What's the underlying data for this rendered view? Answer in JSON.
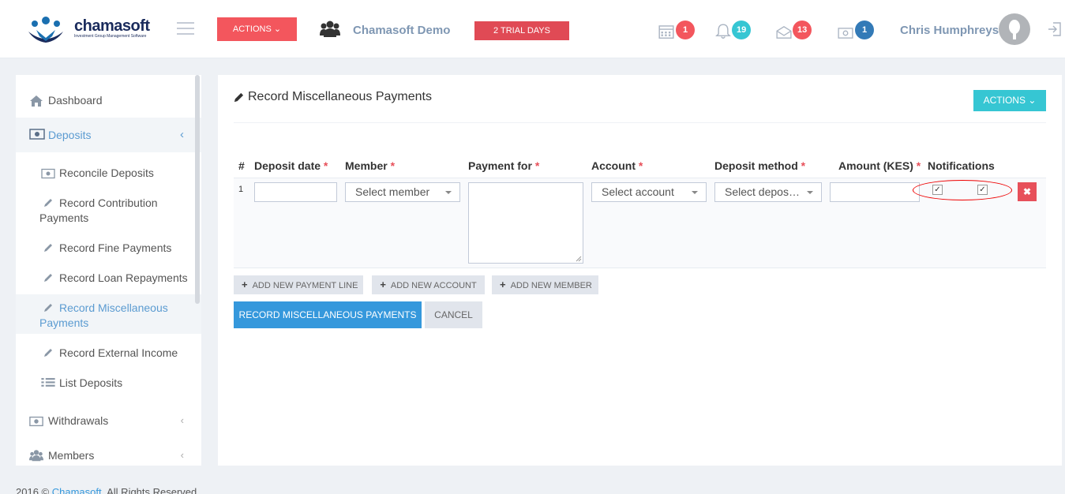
{
  "header": {
    "logo_text": "chamasoft",
    "logo_tagline": "Investment Group Management Software",
    "actions_label": "ACTIONS",
    "group_name": "Chamasoft Demo",
    "trial_label": "2 TRIAL DAYS",
    "badges": [
      {
        "icon": "calendar-icon",
        "count": "1",
        "color": "#f3565d"
      },
      {
        "icon": "bell-icon",
        "count": "19",
        "color": "#36c6d3"
      },
      {
        "icon": "envelope-icon",
        "count": "13",
        "color": "#f3565d"
      },
      {
        "icon": "money-icon",
        "count": "1",
        "color": "#337ab7"
      }
    ],
    "user_name": "Chris Humphreys"
  },
  "sidebar": {
    "items": [
      {
        "label": "Dashboard",
        "icon": "home-icon"
      },
      {
        "label": "Deposits",
        "icon": "money-icon"
      },
      {
        "label": "Withdrawals",
        "icon": "money-icon"
      },
      {
        "label": "Members",
        "icon": "users-icon"
      }
    ],
    "deposit_subitems": [
      {
        "label": "Reconcile Deposits",
        "icon": "money-icon"
      },
      {
        "label": "Record Contribution Payments",
        "icon": "pencil-icon"
      },
      {
        "label": "Record Fine Payments",
        "icon": "pencil-icon"
      },
      {
        "label": "Record Loan Repayments",
        "icon": "pencil-icon"
      },
      {
        "label": "Record Miscellaneous Payments",
        "icon": "pencil-icon"
      },
      {
        "label": "Record External Income",
        "icon": "pencil-icon"
      },
      {
        "label": "List Deposits",
        "icon": "list-icon"
      }
    ]
  },
  "main": {
    "title": "Record Miscellaneous Payments",
    "actions_label": "ACTIONS",
    "columns": [
      "#",
      "Deposit date",
      "Member",
      "Payment for",
      "Account",
      "Deposit method",
      "Amount (KES)",
      "Notifications"
    ],
    "required_marker": "*",
    "row": {
      "number": "1",
      "member_placeholder": "Select member",
      "account_placeholder": "Select account",
      "deposit_method_placeholder": "Select depos…",
      "notification_checks": [
        "✓",
        "✓"
      ],
      "delete_symbol": "✖"
    },
    "add_payment_line": "ADD NEW PAYMENT LINE",
    "add_account": "ADD NEW ACCOUNT",
    "add_member": "ADD NEW MEMBER",
    "plus_symbol": "+",
    "submit_label": "RECORD MISCELLANEOUS PAYMENTS",
    "cancel_label": "CANCEL"
  },
  "footer": {
    "text_prefix": "2016 © ",
    "link": "Chamasoft",
    "text_suffix": ". All Rights Reserved"
  },
  "colors": {
    "accent": "#3598dc",
    "danger": "#f3565d",
    "info": "#36c6d3"
  }
}
